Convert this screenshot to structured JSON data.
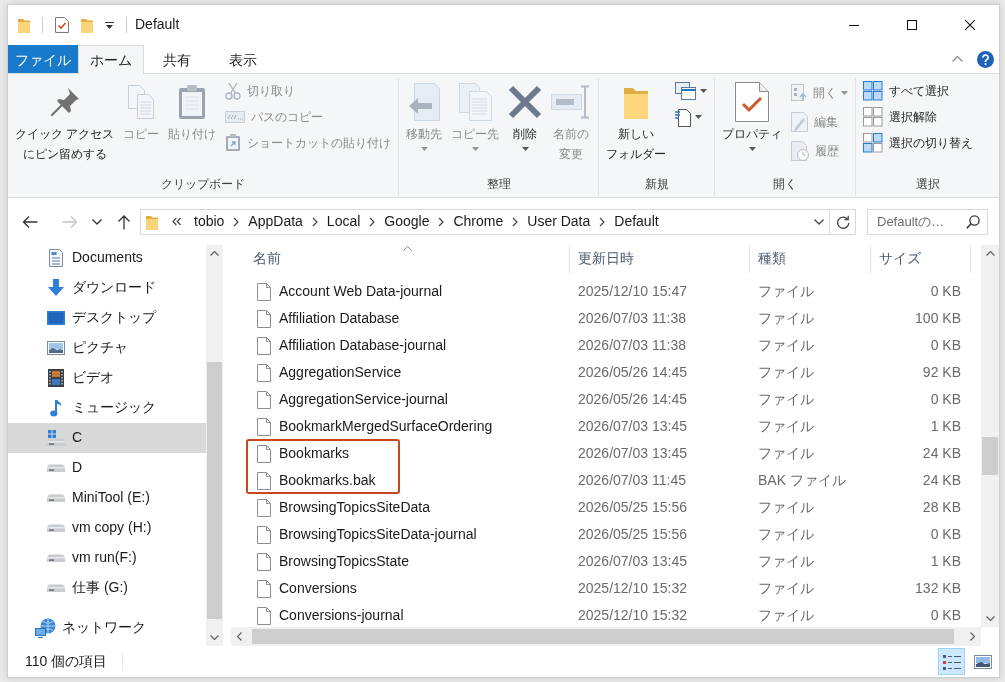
{
  "window": {
    "title": "Default"
  },
  "ribbon": {
    "tabs": [
      {
        "label": "ファイル",
        "kind": "file",
        "selected": false
      },
      {
        "label": "ホーム",
        "kind": "tab",
        "selected": true
      },
      {
        "label": "共有",
        "kind": "tab",
        "selected": false
      },
      {
        "label": "表示",
        "kind": "tab",
        "selected": false
      }
    ],
    "groups": [
      {
        "label": "クリップボード",
        "commands": [
          {
            "kind": "large",
            "lines": [
              "クイック アクセス",
              "にピン留めする"
            ],
            "disabled": false,
            "dropdown": false
          },
          {
            "kind": "large",
            "lines": [
              "コピー"
            ],
            "disabled": true,
            "dropdown": false
          },
          {
            "kind": "large",
            "lines": [
              "貼り付け"
            ],
            "disabled": true,
            "dropdown": false
          },
          {
            "kind": "small",
            "label": "切り取り",
            "disabled": true,
            "dropdown": false
          },
          {
            "kind": "small",
            "label": "パスのコピー",
            "disabled": true,
            "dropdown": false
          },
          {
            "kind": "small",
            "label": "ショートカットの貼り付け",
            "disabled": true,
            "dropdown": false
          }
        ]
      },
      {
        "label": "整理",
        "commands": [
          {
            "kind": "large",
            "lines": [
              "移動先"
            ],
            "disabled": true,
            "dropdown": true
          },
          {
            "kind": "large",
            "lines": [
              "コピー先"
            ],
            "disabled": true,
            "dropdown": true
          },
          {
            "kind": "large",
            "lines": [
              "削除"
            ],
            "disabled": false,
            "dropdown": true
          },
          {
            "kind": "large",
            "lines": [
              "名前の",
              "変更"
            ],
            "disabled": true,
            "dropdown": false
          }
        ]
      },
      {
        "label": "新規",
        "commands": [
          {
            "kind": "large",
            "lines": [
              "新しい",
              "フォルダー"
            ],
            "disabled": false,
            "dropdown": false
          },
          {
            "kind": "icon",
            "disabled": false,
            "dropdown": true
          },
          {
            "kind": "icon",
            "disabled": false,
            "dropdown": true
          }
        ]
      },
      {
        "label": "開く",
        "commands": [
          {
            "kind": "large",
            "lines": [
              "プロパティ"
            ],
            "disabled": false,
            "dropdown": true
          },
          {
            "kind": "small",
            "label": "開く",
            "disabled": true,
            "dropdown": true
          },
          {
            "kind": "small",
            "label": "編集",
            "disabled": true,
            "dropdown": false
          },
          {
            "kind": "small",
            "label": "履歴",
            "disabled": true,
            "dropdown": false
          }
        ]
      },
      {
        "label": "選択",
        "commands": [
          {
            "kind": "small",
            "label": "すべて選択",
            "disabled": false,
            "dropdown": false
          },
          {
            "kind": "small",
            "label": "選択解除",
            "disabled": false,
            "dropdown": false
          },
          {
            "kind": "small",
            "label": "選択の切り替え",
            "disabled": false,
            "dropdown": false
          }
        ]
      }
    ]
  },
  "navigation_buttons": [
    {
      "disabled": false
    },
    {
      "disabled": true
    },
    {
      "disabled": false
    },
    {
      "disabled": false
    }
  ],
  "address_bar": {
    "path": [
      "tobio",
      "AppData",
      "Local",
      "Google",
      "Chrome",
      "User Data",
      "Default"
    ]
  },
  "search": {
    "placeholder": "Defaultの…"
  },
  "sidebar": {
    "items": [
      {
        "label": "Documents",
        "selected": false
      },
      {
        "label": "ダウンロード",
        "selected": false
      },
      {
        "label": "デスクトップ",
        "selected": false
      },
      {
        "label": "ピクチャ",
        "selected": false
      },
      {
        "label": "ビデオ",
        "selected": false
      },
      {
        "label": "ミュージック",
        "selected": false
      },
      {
        "label": "C",
        "selected": true
      },
      {
        "label": "D",
        "selected": false
      },
      {
        "label": "MiniTool (E:)",
        "selected": false
      },
      {
        "label": "vm copy (H:)",
        "selected": false
      },
      {
        "label": "vm run(F:)",
        "selected": false
      },
      {
        "label": "仕事 (G:)",
        "selected": false
      }
    ],
    "network": {
      "label": "ネットワーク",
      "selected": false
    }
  },
  "table": {
    "columns": [
      {
        "label": "名前",
        "sorted": true
      },
      {
        "label": "更新日時",
        "sorted": false
      },
      {
        "label": "種類",
        "sorted": false
      },
      {
        "label": "サイズ",
        "sorted": false
      }
    ],
    "rows": [
      {
        "name": "Account Web Data-journal",
        "modified": "2025/12/10 15:47",
        "type": "ファイル",
        "size": "0 KB",
        "highlighted": false
      },
      {
        "name": "Affiliation Database",
        "modified": "2026/07/03 11:38",
        "type": "ファイル",
        "size": "100 KB",
        "highlighted": false
      },
      {
        "name": "Affiliation Database-journal",
        "modified": "2026/07/03 11:38",
        "type": "ファイル",
        "size": "0 KB",
        "highlighted": false
      },
      {
        "name": "AggregationService",
        "modified": "2026/05/26 14:45",
        "type": "ファイル",
        "size": "92 KB",
        "highlighted": false
      },
      {
        "name": "AggregationService-journal",
        "modified": "2026/05/26 14:45",
        "type": "ファイル",
        "size": "0 KB",
        "highlighted": false
      },
      {
        "name": "BookmarkMergedSurfaceOrdering",
        "modified": "2026/07/03 13:45",
        "type": "ファイル",
        "size": "1 KB",
        "highlighted": false
      },
      {
        "name": "Bookmarks",
        "modified": "2026/07/03 13:45",
        "type": "ファイル",
        "size": "24 KB",
        "highlighted": true
      },
      {
        "name": "Bookmarks.bak",
        "modified": "2026/07/03 11:45",
        "type": "BAK ファイル",
        "size": "24 KB",
        "highlighted": true
      },
      {
        "name": "BrowsingTopicsSiteData",
        "modified": "2026/05/25 15:56",
        "type": "ファイル",
        "size": "28 KB",
        "highlighted": false
      },
      {
        "name": "BrowsingTopicsSiteData-journal",
        "modified": "2026/05/25 15:56",
        "type": "ファイル",
        "size": "0 KB",
        "highlighted": false
      },
      {
        "name": "BrowsingTopicsState",
        "modified": "2026/07/03 13:45",
        "type": "ファイル",
        "size": "1 KB",
        "highlighted": false
      },
      {
        "name": "Conversions",
        "modified": "2025/12/10 15:32",
        "type": "ファイル",
        "size": "132 KB",
        "highlighted": false
      },
      {
        "name": "Conversions-journal",
        "modified": "2025/12/10 15:32",
        "type": "ファイル",
        "size": "0 KB",
        "highlighted": false
      }
    ]
  },
  "status_bar": {
    "item_count": "110 個の項目",
    "view_buttons": [
      {
        "selected": true
      },
      {
        "selected": false
      }
    ]
  }
}
